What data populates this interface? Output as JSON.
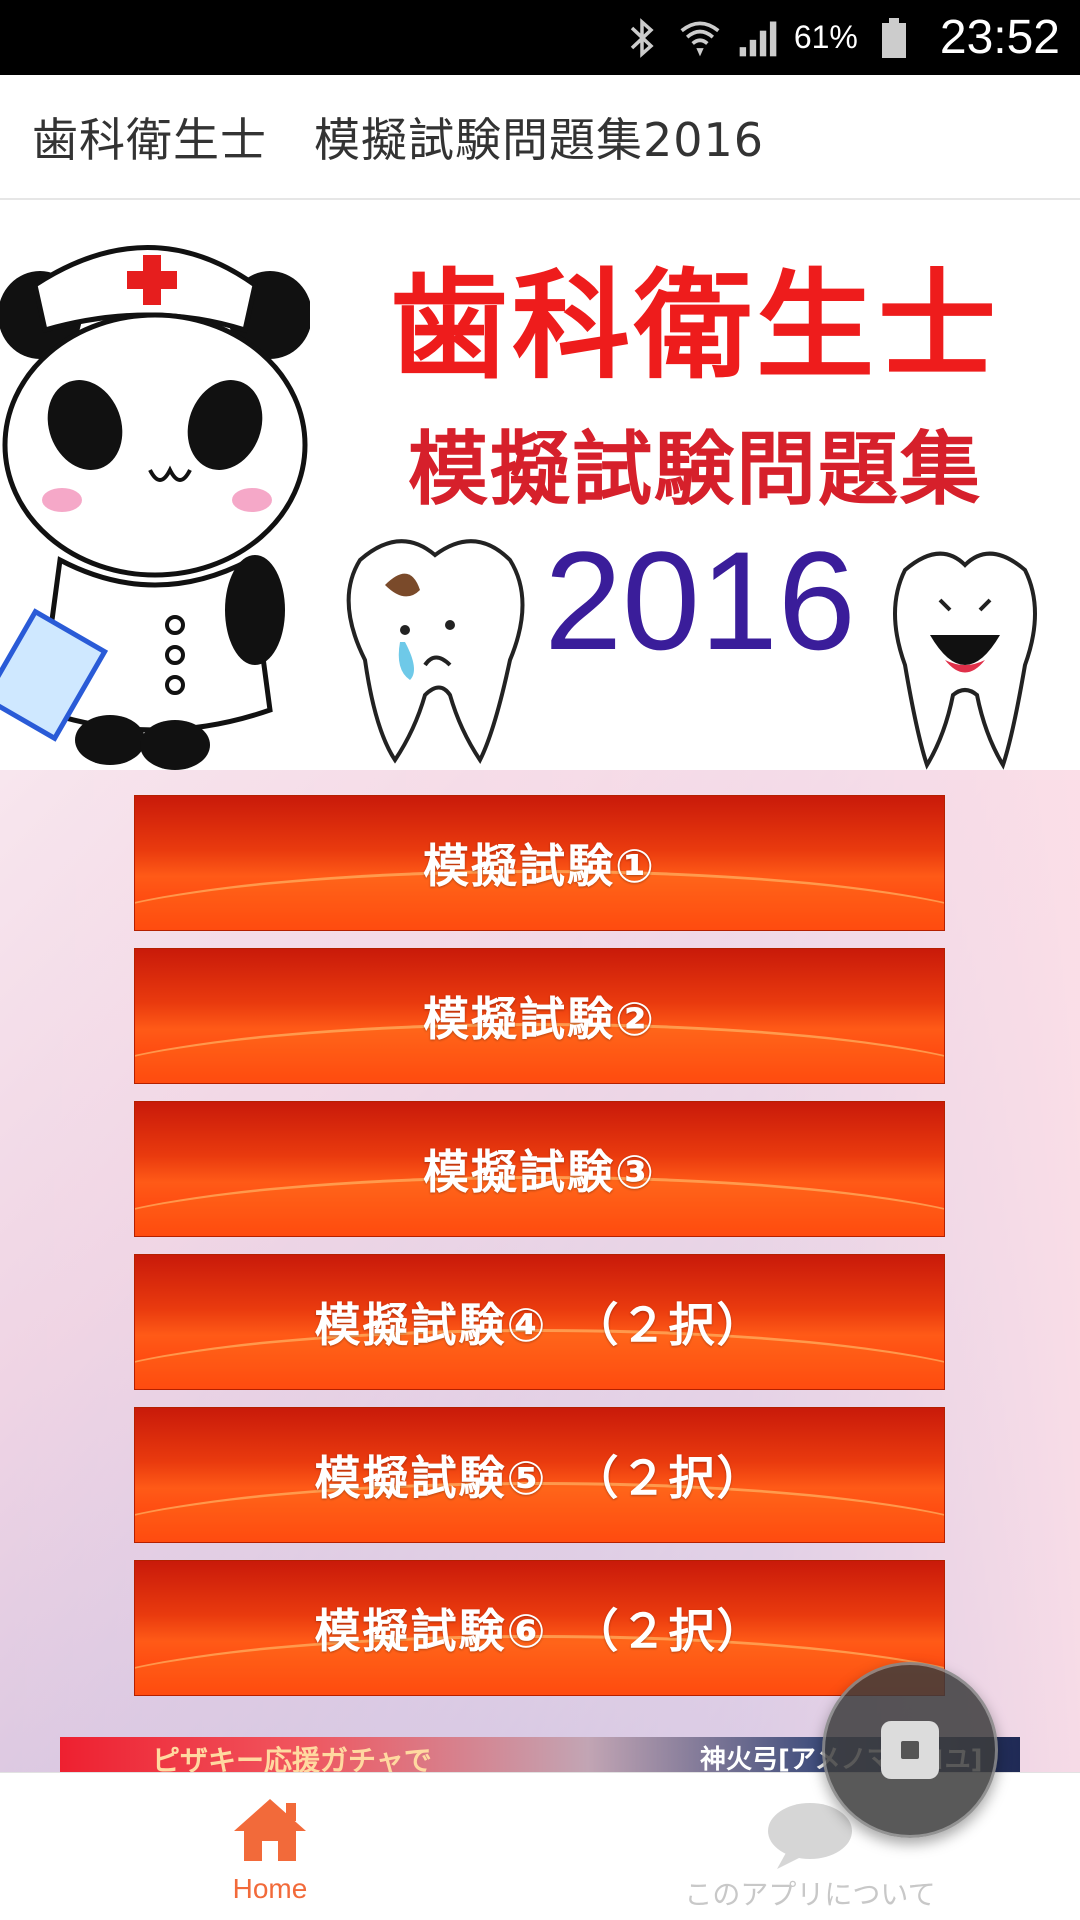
{
  "status_bar": {
    "battery_percent": "61%",
    "time": "23:52",
    "icons": [
      "bluetooth-icon",
      "wifi-icon",
      "signal-icon",
      "battery-icon"
    ]
  },
  "app_bar": {
    "title": "歯科衛生士　模擬試験問題集2016"
  },
  "banner": {
    "title_line1": "歯科衛生士",
    "title_line2": "模擬試験問題集",
    "year": "2016"
  },
  "menu": {
    "buttons": [
      {
        "label": "模擬試験①"
      },
      {
        "label": "模擬試験②"
      },
      {
        "label": "模擬試験③"
      },
      {
        "label": "模擬試験④　（２択）"
      },
      {
        "label": "模擬試験⑤　（２択）"
      },
      {
        "label": "模擬試験⑥　（２択）"
      }
    ]
  },
  "ad": {
    "left_text": "ピザキー応援ガチャで",
    "right_text": "神火弓[アメノマカコユ]"
  },
  "bottom_nav": {
    "home_label": "Home",
    "about_label": "このアプリについて"
  },
  "colors": {
    "accent": "#f26a3a",
    "button_red": "#e93a0e",
    "banner_red": "#ee1c1c",
    "banner_purple": "#3a1d9a"
  }
}
